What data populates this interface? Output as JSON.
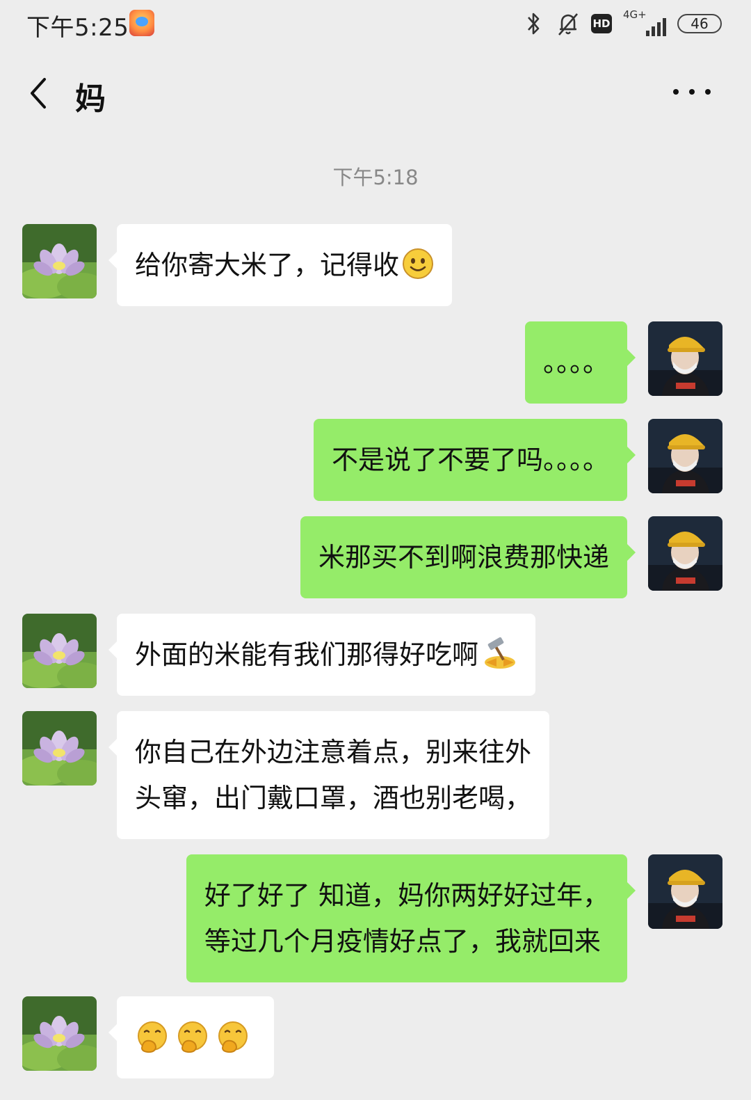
{
  "status_bar": {
    "time": "下午5:25",
    "hd_label": "HD",
    "network_label": "4G+",
    "battery_level": "46"
  },
  "header": {
    "title": "妈"
  },
  "timestamp": "下午5:18",
  "icons": {
    "back": "chevron-left-icon",
    "more": "more-dots-icon",
    "bluetooth": "bluetooth-icon",
    "mute": "bell-off-icon",
    "signal": "signal-icon",
    "battery": "battery-icon"
  },
  "colors": {
    "background": "#ededed",
    "sent_bubble": "#95ec69",
    "received_bubble": "#ffffff",
    "timestamp_text": "#888888"
  },
  "messages": [
    {
      "sender": "mom",
      "lines": [
        "给你寄大米了，记得收"
      ],
      "emoji": "smile"
    },
    {
      "sender": "me",
      "lines": [
        "。。。。"
      ]
    },
    {
      "sender": "me",
      "lines": [
        "不是说了不要了吗。。。。"
      ]
    },
    {
      "sender": "me",
      "lines": [
        "米那买不到啊浪费那快递"
      ]
    },
    {
      "sender": "mom",
      "lines": [
        "外面的米能有我们那得好吃啊"
      ],
      "emoji": "hammer"
    },
    {
      "sender": "mom",
      "lines": [
        "你自己在外边注意着点，别来往外",
        "头窜，出门戴口罩，酒也别老喝，"
      ]
    },
    {
      "sender": "me",
      "lines": [
        "好了好了 知道，妈你两好好过年，",
        "等过几个月疫情好点了，我就回来"
      ]
    },
    {
      "sender": "mom",
      "lines": [
        ""
      ],
      "emoji": "hand-over-mouth x3"
    }
  ]
}
